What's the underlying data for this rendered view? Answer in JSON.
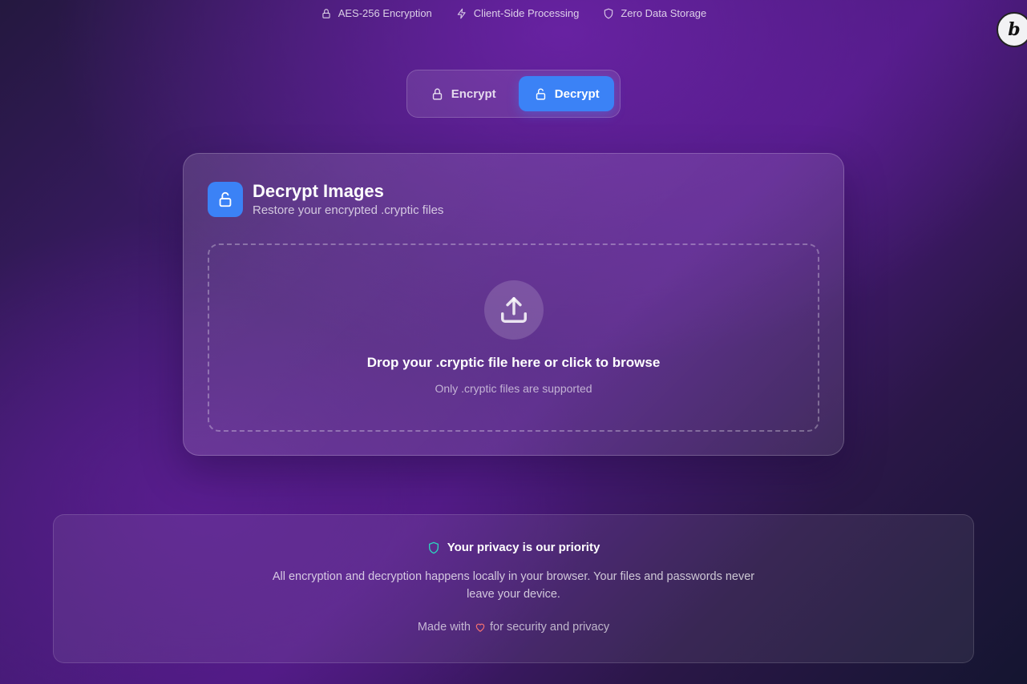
{
  "features": [
    {
      "icon": "lock-icon",
      "label": "AES-256 Encryption"
    },
    {
      "icon": "bolt-icon",
      "label": "Client-Side Processing"
    },
    {
      "icon": "shield-icon",
      "label": "Zero Data Storage"
    }
  ],
  "badge": {
    "letter": "b"
  },
  "mode_toggle": {
    "encrypt_label": "Encrypt",
    "decrypt_label": "Decrypt",
    "active": "Decrypt"
  },
  "card": {
    "title": "Decrypt Images",
    "subtitle": "Restore your encrypted .cryptic files",
    "dropzone": {
      "title": "Drop your .cryptic file here or click to browse",
      "subtitle": "Only .cryptic files are supported"
    }
  },
  "privacy": {
    "heading": "Your privacy is our priority",
    "text": "All encryption and decryption happens locally in your browser. Your files and passwords never leave your device.",
    "made_with_prefix": "Made with",
    "made_with_suffix": "for security and privacy"
  },
  "colors": {
    "accent": "#3b82f6",
    "shield_accent": "#2dd4bf",
    "heart": "#f87171"
  }
}
